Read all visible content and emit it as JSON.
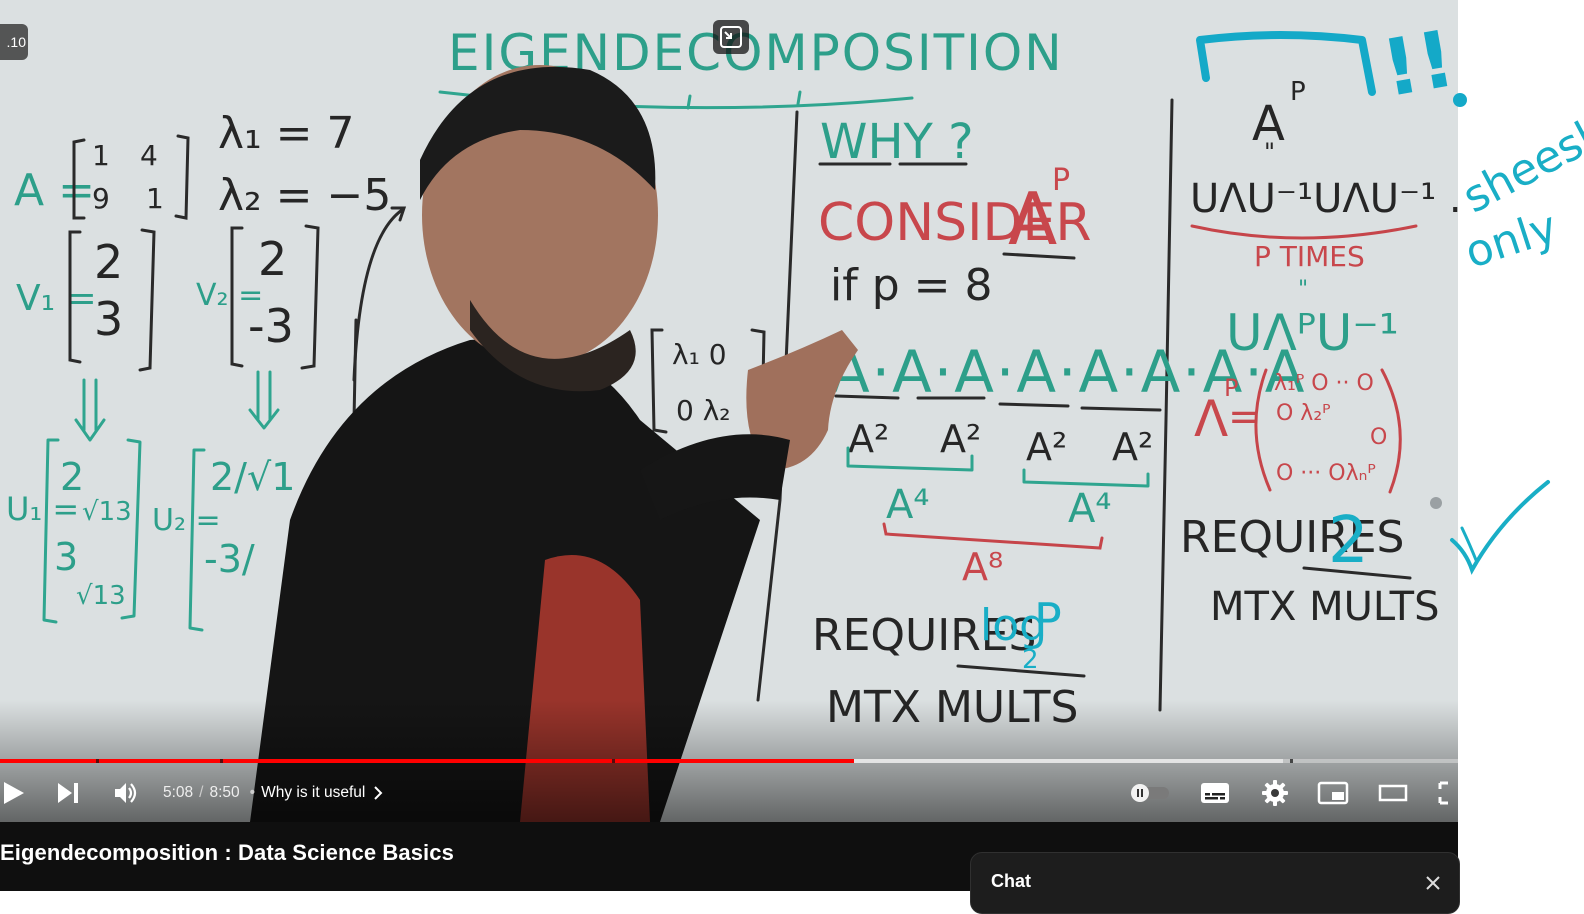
{
  "player": {
    "chapter_badge": ".10",
    "current_time": "5:08",
    "duration": "8:50",
    "time_separator": "/",
    "chapter_separator": "•",
    "chapter_title": "Why is it useful",
    "progress_played": 0.586,
    "progress_buffered": 0.88
  },
  "controls": {
    "play": "play-icon",
    "next": "next-icon",
    "volume": "volume-icon",
    "autoplay": "autoplay-toggle",
    "subtitles": "subtitles-icon",
    "settings": "gear-icon",
    "miniplayer": "miniplayer-icon",
    "theater": "theater-icon",
    "fullscreen": "fullscreen-icon"
  },
  "video": {
    "title": "Eigendecomposition : Data Science Basics"
  },
  "chat": {
    "title": "Chat"
  },
  "whiteboard": {
    "heading": "EIGENDECOMPOSITION",
    "matrix_a": "A =",
    "lambda1": "λ₁ = 7",
    "lambda2": "λ₂ = −5",
    "v1": "V₁ =",
    "v2": "V₂ =",
    "u1": "U₁ =",
    "u2": "U₂ =",
    "why": "WHY ?",
    "consider": "CONSIDER",
    "a_p": "A",
    "p_sup": "P",
    "if_p": "if p = 8",
    "requires_log": "REQUIRES",
    "log_expr": "log",
    "mtx_mults": "MTX MULTS",
    "a_squared": "A²",
    "a_fourth": "A⁴",
    "a_eighth": "A⁸",
    "u_chain": "UΛU⁻¹UΛU⁻¹ ... UΛU⁻¹",
    "p_times": "P TIMES",
    "u_lambda_p": "UΛᴾU⁻¹",
    "requires_two": "REQUIRES",
    "two": "2"
  },
  "annotations": {
    "sheesh": "sheesh",
    "only": "only",
    "exclaim": "!!"
  }
}
